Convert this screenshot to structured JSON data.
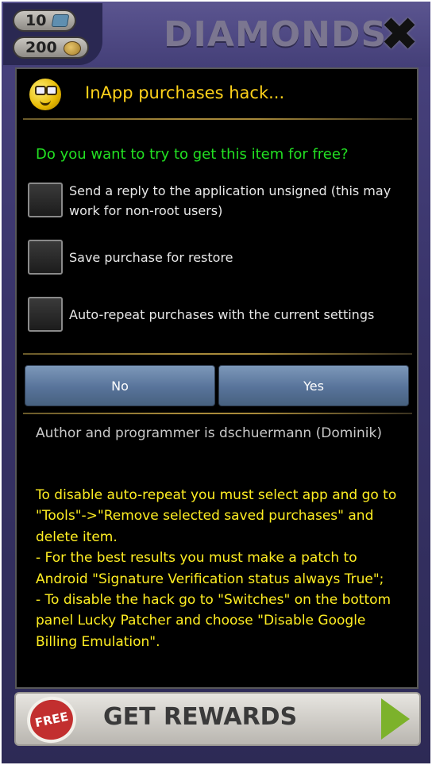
{
  "game": {
    "diamonds_count": "10",
    "coins_count": "200",
    "title": "DIAMONDS",
    "close_glyph": "✖",
    "rewards_badge": "FREE",
    "rewards_label": "GET REWARDS"
  },
  "dialog": {
    "title": "InApp purchases hack...",
    "question": "Do you want to try to get this item for free?",
    "options": [
      {
        "label": "Send a reply to the application unsigned (this may work for non-root users)",
        "checked": false
      },
      {
        "label": "Save purchase for restore",
        "checked": false
      },
      {
        "label": "Auto-repeat purchases with the current settings",
        "checked": false
      }
    ],
    "buttons": {
      "no": "No",
      "yes": "Yes"
    },
    "author": "Author and programmer is dschuermann (Dominik)",
    "info": "To disable auto-repeat you must select app and go to \"Tools\"->\"Remove selected saved purchases\" and delete item.\n- For the best results you must make a patch to Android \"Signature Verification status always True\";\n- To disable the hack go to \"Switches\" on the bottom panel Lucky Patcher and choose \"Disable Google Billing Emulation\"."
  },
  "colors": {
    "title": "#ffd21a",
    "question": "#22e022",
    "info": "#ffee22",
    "button": "#58739a"
  },
  "icons": [
    "gem-icon",
    "coin-icon",
    "close-icon",
    "free-badge-icon",
    "arrow-right-icon",
    "smiley-icon"
  ]
}
